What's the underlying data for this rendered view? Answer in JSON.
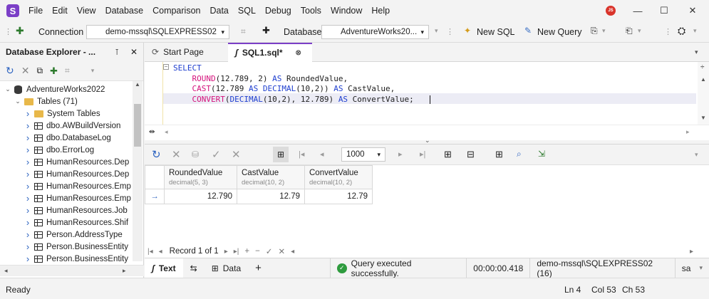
{
  "app": {
    "logo_letter": "S",
    "avatar": "JS",
    "accent": "#7b3fc7"
  },
  "menu": [
    "File",
    "Edit",
    "View",
    "Database",
    "Comparison",
    "Data",
    "SQL",
    "Debug",
    "Tools",
    "Window",
    "Help"
  ],
  "toolbar": {
    "connection_label": "Connection",
    "connection_value": "demo-mssql\\SQLEXPRESS02",
    "database_label": "Database",
    "database_value": "AdventureWorks20...",
    "new_sql": "New SQL",
    "new_query": "New Query"
  },
  "explorer": {
    "title": "Database Explorer - ...",
    "items": [
      {
        "label": "AdventureWorks2022",
        "kind": "db",
        "level": 0,
        "chev": "⌄"
      },
      {
        "label": "Tables (71)",
        "kind": "folder",
        "level": 1,
        "chev": "⌄"
      },
      {
        "label": "System Tables",
        "kind": "folder",
        "level": 2,
        "chev": "›"
      },
      {
        "label": "dbo.AWBuildVersion",
        "kind": "table",
        "level": 2,
        "chev": "›"
      },
      {
        "label": "dbo.DatabaseLog",
        "kind": "table",
        "level": 2,
        "chev": "›"
      },
      {
        "label": "dbo.ErrorLog",
        "kind": "table",
        "level": 2,
        "chev": "›"
      },
      {
        "label": "HumanResources.Dep",
        "kind": "table",
        "level": 2,
        "chev": "›"
      },
      {
        "label": "HumanResources.Dep",
        "kind": "table",
        "level": 2,
        "chev": "›"
      },
      {
        "label": "HumanResources.Emp",
        "kind": "table",
        "level": 2,
        "chev": "›"
      },
      {
        "label": "HumanResources.Emp",
        "kind": "table",
        "level": 2,
        "chev": "›"
      },
      {
        "label": "HumanResources.Job",
        "kind": "table",
        "level": 2,
        "chev": "›"
      },
      {
        "label": "HumanResources.Shif",
        "kind": "table",
        "level": 2,
        "chev": "›"
      },
      {
        "label": "Person.AddressType",
        "kind": "table",
        "level": 2,
        "chev": "›"
      },
      {
        "label": "Person.BusinessEntity",
        "kind": "table",
        "level": 2,
        "chev": "›"
      },
      {
        "label": "Person.BusinessEntity",
        "kind": "table",
        "level": 2,
        "chev": "›"
      }
    ]
  },
  "tabs": [
    {
      "label": "Start Page",
      "active": false
    },
    {
      "label": "SQL1.sql*",
      "active": true
    }
  ],
  "editor": {
    "lines": [
      {
        "parts": [
          [
            "kw",
            "SELECT"
          ]
        ]
      },
      {
        "parts": [
          [
            "pl",
            "    "
          ],
          [
            "fn",
            "ROUND"
          ],
          [
            "pl",
            "(12.789, 2) "
          ],
          [
            "kw",
            "AS"
          ],
          [
            "pl",
            " RoundedValue,"
          ]
        ]
      },
      {
        "parts": [
          [
            "pl",
            "    "
          ],
          [
            "fn",
            "CAST"
          ],
          [
            "pl",
            "(12.789 "
          ],
          [
            "kw",
            "AS"
          ],
          [
            "pl",
            " "
          ],
          [
            "kw",
            "DECIMAL"
          ],
          [
            "pl",
            "(10,2)) "
          ],
          [
            "kw",
            "AS"
          ],
          [
            "pl",
            " CastValue,"
          ]
        ]
      },
      {
        "parts": [
          [
            "pl",
            "    "
          ],
          [
            "fn",
            "CONVERT"
          ],
          [
            "pl",
            "("
          ],
          [
            "kw",
            "DECIMAL"
          ],
          [
            "pl",
            "(10,2), 12.789) "
          ],
          [
            "kw",
            "AS"
          ],
          [
            "pl",
            " ConvertValue;"
          ]
        ]
      }
    ]
  },
  "results": {
    "page_size": "1000",
    "columns": [
      {
        "name": "RoundedValue",
        "type": "decimal(5, 3)"
      },
      {
        "name": "CastValue",
        "type": "decimal(10, 2)"
      },
      {
        "name": "ConvertValue",
        "type": "decimal(10, 2)"
      }
    ],
    "rows": [
      [
        "12.790",
        "12.79",
        "12.79"
      ]
    ],
    "record_nav": "Record 1 of 1"
  },
  "bottom": {
    "text_tab": "Text",
    "data_tab": "Data",
    "status_message": "Query executed successfully.",
    "elapsed": "00:00:00.418",
    "server": "demo-mssql\\SQLEXPRESS02 (16)",
    "user": "sa"
  },
  "statusbar": {
    "left": "Ready",
    "ln": "Ln 4",
    "col": "Col 53",
    "ch": "Ch 53"
  }
}
